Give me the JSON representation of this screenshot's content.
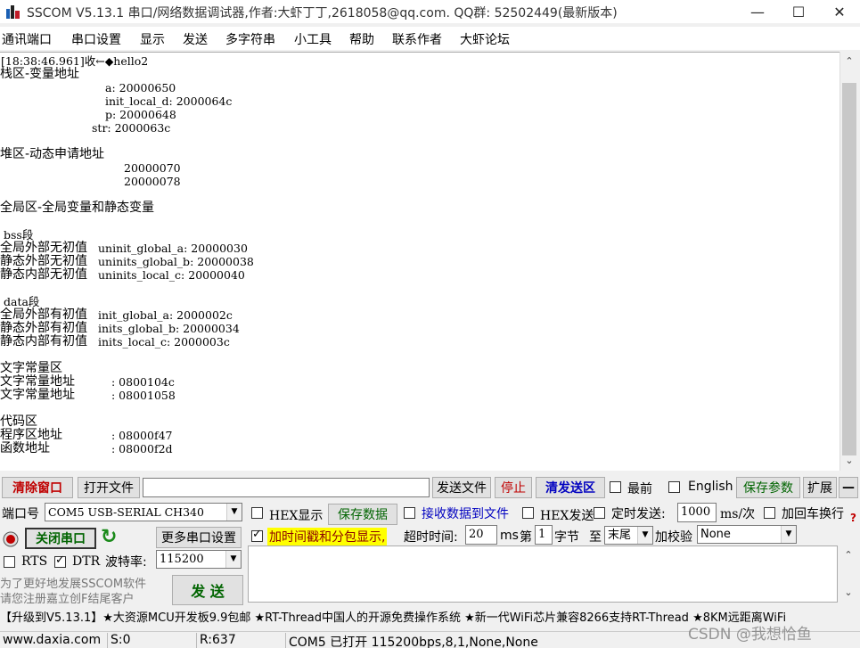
{
  "title": "SSCOM V5.13.1 串口/网络数据调试器,作者:大虾丁丁,2618058@qq.com. QQ群: 52502449(最新版本)",
  "window_controls": {
    "minimize": "—",
    "maximize": "☐",
    "close": "✕"
  },
  "menu": [
    "通讯端口",
    "串口设置",
    "显示",
    "发送",
    "多字符串",
    "小工具",
    "帮助",
    "联系作者",
    "大虾论坛"
  ],
  "recv": {
    "header": "[18:38:46.961]收←◆hello2",
    "stack_title": "栈区-变量地址",
    "stack_lines": [
      "a: 20000650",
      "init_local_d: 2000064c",
      "p: 20000648",
      "str: 2000063c"
    ],
    "heap_title": "堆区-动态申请地址",
    "heap_lines": [
      "20000070",
      "20000078"
    ],
    "global_title": "全局区-全局变量和静态变量",
    "bss_title": "bss段",
    "bss_lines": [
      {
        "cn": "全局外部无初值",
        "v": "uninit_global_a: 20000030"
      },
      {
        "cn": "静态外部无初值",
        "v": "uninits_global_b: 20000038"
      },
      {
        "cn": "静态内部无初值",
        "v": "uninits_local_c: 20000040"
      }
    ],
    "data_title": "data段",
    "data_lines": [
      {
        "cn": "全局外部有初值",
        "v": "init_global_a: 2000002c"
      },
      {
        "cn": "静态外部有初值",
        "v": "inits_global_b: 20000034"
      },
      {
        "cn": "静态内部有初值",
        "v": "inits_local_c: 2000003c"
      }
    ],
    "const_title": "文字常量区",
    "const_lines": [
      {
        "cn": "文字常量地址",
        "v": ": 0800104c"
      },
      {
        "cn": "文字常量地址",
        "v": ": 08001058"
      }
    ],
    "code_title": "代码区",
    "code_lines": [
      {
        "cn": "程序区地址",
        "v": ": 08000f47"
      },
      {
        "cn": "函数地址",
        "v": ": 08000f2d"
      }
    ]
  },
  "toolbar1": {
    "clear": "清除窗口",
    "open_file": "打开文件",
    "send_file": "发送文件",
    "stop": "停止",
    "clear_send": "清发送区",
    "latest": "最前",
    "english": "English",
    "save_params": "保存参数",
    "expand": "扩展",
    "collapse": "—"
  },
  "port": {
    "label": "端口号",
    "value": "COM5 USB-SERIAL CH340",
    "hex_display": "HEX显示",
    "save_data": "保存数据",
    "recv_to_file": "接收数据到文件",
    "hex_send": "HEX发送",
    "timed_send": "定时发送:",
    "interval": "1000",
    "interval_unit": "ms/次",
    "crlf": "加回车换行",
    "help_mark": "?"
  },
  "row3": {
    "close_port": "关闭串口",
    "refresh_icon": "↻",
    "more_settings": "更多串口设置",
    "timestamp": "加时间戳和分包显示,",
    "timeout_label": "超时时间:",
    "timeout": "20",
    "ms": "ms",
    "byte_prefix": "第",
    "byte_num": "1",
    "byte_suffix": "字节",
    "to": "至",
    "end": "末尾",
    "checksum": "加校验",
    "checksum_value": "None"
  },
  "row4": {
    "rts": "RTS",
    "dtr": "DTR",
    "baud_label": "波特率:",
    "baud": "115200"
  },
  "promo": {
    "line1": "为了更好地发展SSCOM软件",
    "line2": "请您注册嘉立创F结尾客户",
    "send": "发 送"
  },
  "adline": "【升级到V5.13.1】★大资源MCU开发板9.9包邮 ★RT-Thread中国人的开源免费操作系统 ★新一代WiFi芯片兼容8266支持RT-Thread ★8KM远距离WiFi",
  "status": {
    "site": "www.daxia.com",
    "s": "S:0",
    "r": "R:637",
    "port_status": "COM5 已打开  115200bps,8,1,None,None"
  },
  "watermark": "CSDN @我想恰鱼",
  "colors": {
    "accent_red": "#c00000",
    "link_blue": "#0000c0",
    "highlight_yellow": "#ffff00"
  }
}
